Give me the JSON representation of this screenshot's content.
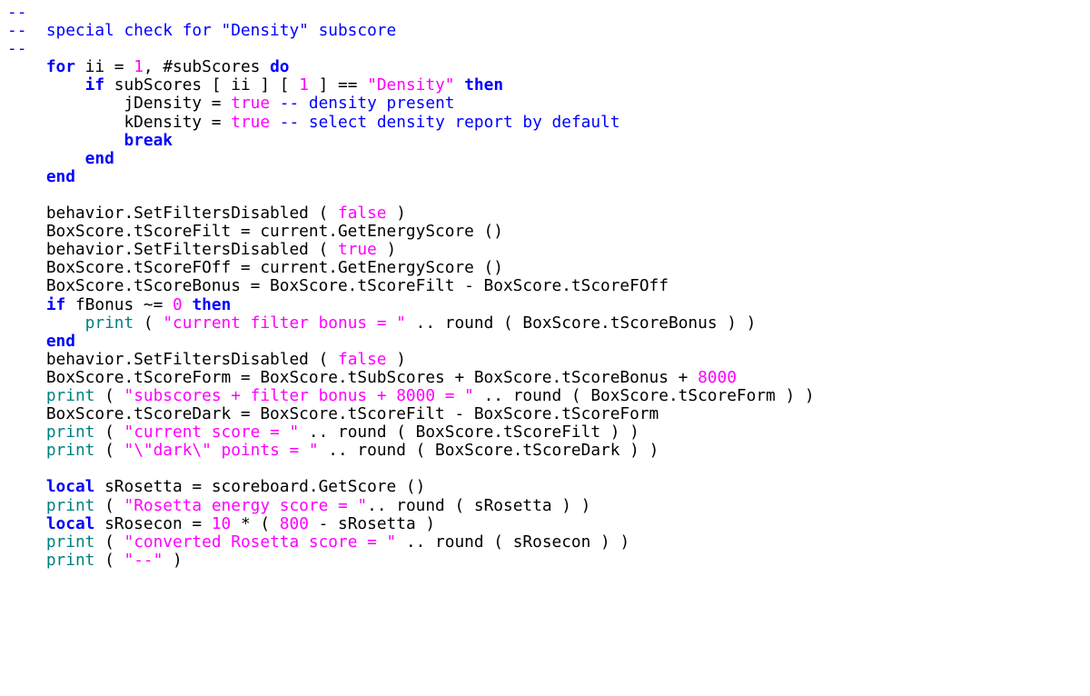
{
  "code": {
    "tokens": [
      {
        "cls": "c-blue",
        "text": "--"
      },
      {
        "cls": null,
        "text": "\n"
      },
      {
        "cls": "c-blue",
        "text": "--  special check for \"Density\" subscore"
      },
      {
        "cls": null,
        "text": "\n"
      },
      {
        "cls": "c-blue",
        "text": "--"
      },
      {
        "cls": null,
        "text": "\n"
      },
      {
        "cls": null,
        "text": "    "
      },
      {
        "cls": "c-keyword",
        "text": "for"
      },
      {
        "cls": null,
        "text": " ii = "
      },
      {
        "cls": "c-number",
        "text": "1"
      },
      {
        "cls": null,
        "text": ", #subScores "
      },
      {
        "cls": "c-keyword",
        "text": "do"
      },
      {
        "cls": null,
        "text": "\n"
      },
      {
        "cls": null,
        "text": "        "
      },
      {
        "cls": "c-keyword",
        "text": "if"
      },
      {
        "cls": null,
        "text": " subScores [ ii ] [ "
      },
      {
        "cls": "c-number",
        "text": "1"
      },
      {
        "cls": null,
        "text": " ] == "
      },
      {
        "cls": "c-string",
        "text": "\"Density\""
      },
      {
        "cls": null,
        "text": " "
      },
      {
        "cls": "c-keyword",
        "text": "then"
      },
      {
        "cls": null,
        "text": "\n"
      },
      {
        "cls": null,
        "text": "            jDensity = "
      },
      {
        "cls": "c-bool",
        "text": "true"
      },
      {
        "cls": null,
        "text": " "
      },
      {
        "cls": "c-blue",
        "text": "-- density present"
      },
      {
        "cls": null,
        "text": "\n"
      },
      {
        "cls": null,
        "text": "            kDensity = "
      },
      {
        "cls": "c-bool",
        "text": "true"
      },
      {
        "cls": null,
        "text": " "
      },
      {
        "cls": "c-blue",
        "text": "-- select density report by default"
      },
      {
        "cls": null,
        "text": "\n"
      },
      {
        "cls": null,
        "text": "            "
      },
      {
        "cls": "c-keyword",
        "text": "break"
      },
      {
        "cls": null,
        "text": "\n"
      },
      {
        "cls": null,
        "text": "        "
      },
      {
        "cls": "c-keyword",
        "text": "end"
      },
      {
        "cls": null,
        "text": "\n"
      },
      {
        "cls": null,
        "text": "    "
      },
      {
        "cls": "c-keyword",
        "text": "end"
      },
      {
        "cls": null,
        "text": "\n"
      },
      {
        "cls": null,
        "text": "\n"
      },
      {
        "cls": null,
        "text": "    behavior.SetFiltersDisabled ( "
      },
      {
        "cls": "c-bool",
        "text": "false"
      },
      {
        "cls": null,
        "text": " )"
      },
      {
        "cls": null,
        "text": "\n"
      },
      {
        "cls": null,
        "text": "    BoxScore.tScoreFilt = current.GetEnergyScore ()"
      },
      {
        "cls": null,
        "text": "\n"
      },
      {
        "cls": null,
        "text": "    behavior.SetFiltersDisabled ( "
      },
      {
        "cls": "c-bool",
        "text": "true"
      },
      {
        "cls": null,
        "text": " )"
      },
      {
        "cls": null,
        "text": "\n"
      },
      {
        "cls": null,
        "text": "    BoxScore.tScoreFOff = current.GetEnergyScore ()"
      },
      {
        "cls": null,
        "text": "\n"
      },
      {
        "cls": null,
        "text": "    BoxScore.tScoreBonus = BoxScore.tScoreFilt - BoxScore.tScoreFOff"
      },
      {
        "cls": null,
        "text": "\n"
      },
      {
        "cls": null,
        "text": "    "
      },
      {
        "cls": "c-keyword",
        "text": "if"
      },
      {
        "cls": null,
        "text": " fBonus ~= "
      },
      {
        "cls": "c-number",
        "text": "0"
      },
      {
        "cls": null,
        "text": " "
      },
      {
        "cls": "c-keyword",
        "text": "then"
      },
      {
        "cls": null,
        "text": "\n"
      },
      {
        "cls": null,
        "text": "        "
      },
      {
        "cls": "c-func",
        "text": "print"
      },
      {
        "cls": null,
        "text": " ( "
      },
      {
        "cls": "c-string",
        "text": "\"current filter bonus = \""
      },
      {
        "cls": null,
        "text": " .. round ( BoxScore.tScoreBonus ) )"
      },
      {
        "cls": null,
        "text": "\n"
      },
      {
        "cls": null,
        "text": "    "
      },
      {
        "cls": "c-keyword",
        "text": "end"
      },
      {
        "cls": null,
        "text": "\n"
      },
      {
        "cls": null,
        "text": "    behavior.SetFiltersDisabled ( "
      },
      {
        "cls": "c-bool",
        "text": "false"
      },
      {
        "cls": null,
        "text": " )"
      },
      {
        "cls": null,
        "text": "\n"
      },
      {
        "cls": null,
        "text": "    BoxScore.tScoreForm = BoxScore.tSubScores + BoxScore.tScoreBonus + "
      },
      {
        "cls": "c-number",
        "text": "8000"
      },
      {
        "cls": null,
        "text": "\n"
      },
      {
        "cls": null,
        "text": "    "
      },
      {
        "cls": "c-func",
        "text": "print"
      },
      {
        "cls": null,
        "text": " ( "
      },
      {
        "cls": "c-string",
        "text": "\"subscores + filter bonus + 8000 = \""
      },
      {
        "cls": null,
        "text": " .. round ( BoxScore.tScoreForm ) )"
      },
      {
        "cls": null,
        "text": "\n"
      },
      {
        "cls": null,
        "text": "    BoxScore.tScoreDark = BoxScore.tScoreFilt - BoxScore.tScoreForm"
      },
      {
        "cls": null,
        "text": "\n"
      },
      {
        "cls": null,
        "text": "    "
      },
      {
        "cls": "c-func",
        "text": "print"
      },
      {
        "cls": null,
        "text": " ( "
      },
      {
        "cls": "c-string",
        "text": "\"current score = \""
      },
      {
        "cls": null,
        "text": " .. round ( BoxScore.tScoreFilt ) )"
      },
      {
        "cls": null,
        "text": "\n"
      },
      {
        "cls": null,
        "text": "    "
      },
      {
        "cls": "c-func",
        "text": "print"
      },
      {
        "cls": null,
        "text": " ( "
      },
      {
        "cls": "c-string",
        "text": "\"\\\"dark\\\" points = \""
      },
      {
        "cls": null,
        "text": " .. round ( BoxScore.tScoreDark ) )"
      },
      {
        "cls": null,
        "text": "\n"
      },
      {
        "cls": null,
        "text": "\n"
      },
      {
        "cls": null,
        "text": "    "
      },
      {
        "cls": "c-keyword",
        "text": "local"
      },
      {
        "cls": null,
        "text": " sRosetta = scoreboard.GetScore ()"
      },
      {
        "cls": null,
        "text": "\n"
      },
      {
        "cls": null,
        "text": "    "
      },
      {
        "cls": "c-func",
        "text": "print"
      },
      {
        "cls": null,
        "text": " ( "
      },
      {
        "cls": "c-string",
        "text": "\"Rosetta energy score = \""
      },
      {
        "cls": null,
        "text": ".. round ( sRosetta ) )"
      },
      {
        "cls": null,
        "text": "\n"
      },
      {
        "cls": null,
        "text": "    "
      },
      {
        "cls": "c-keyword",
        "text": "local"
      },
      {
        "cls": null,
        "text": " sRosecon = "
      },
      {
        "cls": "c-number",
        "text": "10"
      },
      {
        "cls": null,
        "text": " * ( "
      },
      {
        "cls": "c-number",
        "text": "800"
      },
      {
        "cls": null,
        "text": " - sRosetta )"
      },
      {
        "cls": null,
        "text": "\n"
      },
      {
        "cls": null,
        "text": "    "
      },
      {
        "cls": "c-func",
        "text": "print"
      },
      {
        "cls": null,
        "text": " ( "
      },
      {
        "cls": "c-string",
        "text": "\"converted Rosetta score = \""
      },
      {
        "cls": null,
        "text": " .. round ( sRosecon ) )"
      },
      {
        "cls": null,
        "text": "\n"
      },
      {
        "cls": null,
        "text": "    "
      },
      {
        "cls": "c-func",
        "text": "print"
      },
      {
        "cls": null,
        "text": " ( "
      },
      {
        "cls": "c-string",
        "text": "\"--\""
      },
      {
        "cls": null,
        "text": " )"
      },
      {
        "cls": null,
        "text": "\n"
      }
    ]
  }
}
